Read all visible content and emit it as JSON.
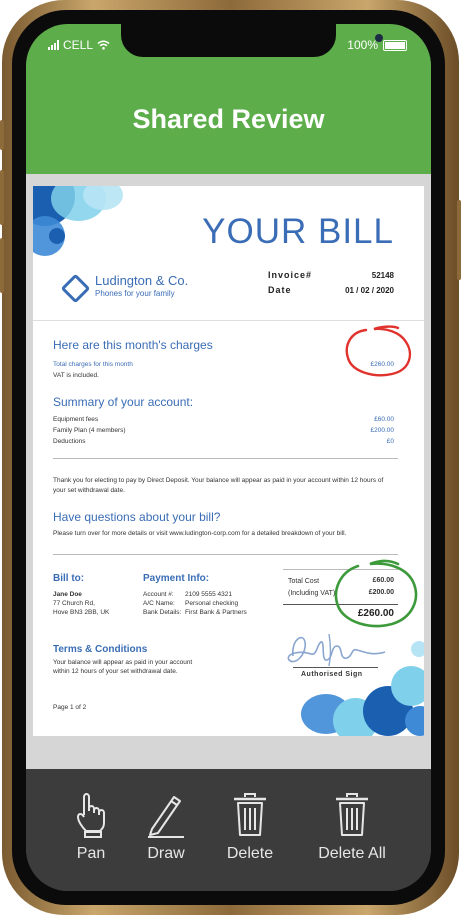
{
  "status": {
    "carrier": "CELL",
    "battery": "100%"
  },
  "header": {
    "title": "Shared Review"
  },
  "document": {
    "heading": "YOUR BILL",
    "company": "Ludington & Co.",
    "tagline": "Phones for your family",
    "invoice_label": "Invoice#",
    "invoice_value": "52148",
    "date_label": "Date",
    "date_value": "01 / 02 / 2020",
    "charges_heading": "Here are this month's charges",
    "total_charges_label": "Total charges for this month",
    "vat_note": "VAT is included.",
    "total_charges_value": "£260.00",
    "summary_heading": "Summary of your account:",
    "summary_items": [
      {
        "label": "Equipment fees",
        "value": "£60.00"
      },
      {
        "label": "Family Plan (4 members)",
        "value": "£200.00"
      },
      {
        "label": "Deductions",
        "value": "£0"
      }
    ],
    "thanks_note": "Thank you for electing to pay by Direct Deposit. Your balance will appear as paid in your account within 12 hours of your set withdrawal date.",
    "questions_heading": "Have questions about your bill?",
    "questions_note": "Please turn over for more details or visit www.ludington-corp.com for a detailed breakdown of your bill.",
    "bill_to_label": "Bill to:",
    "bill_to_name": "Jane Doe",
    "bill_to_addr1": "77 Church Rd,",
    "bill_to_addr2": "Hove BN3 2BB, UK",
    "payment_label": "Payment Info:",
    "account_label": "Account #:",
    "account_value": "2109 5555 4321",
    "ac_name_label": "A/C Name:",
    "ac_name_value": "Personal checking",
    "bank_label": "Bank Details:",
    "bank_value": "First Bank & Partners",
    "total_cost_label": "Total Cost",
    "total_cost_value": "£60.00",
    "including_vat_label": "(Including VAT)",
    "including_vat_value": "£200.00",
    "grand_total": "£260.00",
    "terms_heading": "Terms & Conditions",
    "terms_note": "Your balance will appear as paid in your account within 12 hours of your set withdrawal date.",
    "authorised_sign": "Authorised Sign",
    "page_indicator": "Page 1 of 2"
  },
  "annotations": {
    "red_circle_color": "#e0332d",
    "green_circle_color": "#3d9a3a"
  },
  "toolbar": {
    "pan": "Pan",
    "draw": "Draw",
    "delete": "Delete",
    "delete_all": "Delete All"
  },
  "colors": {
    "header_green": "#5dae4a",
    "accent_blue": "#3a6db5",
    "toolbar_gray": "#3c3c3c"
  },
  "icons": {
    "pan": "hand-pointer-icon",
    "draw": "pencil-icon",
    "delete": "trash-icon",
    "delete_all": "trash-icon"
  }
}
